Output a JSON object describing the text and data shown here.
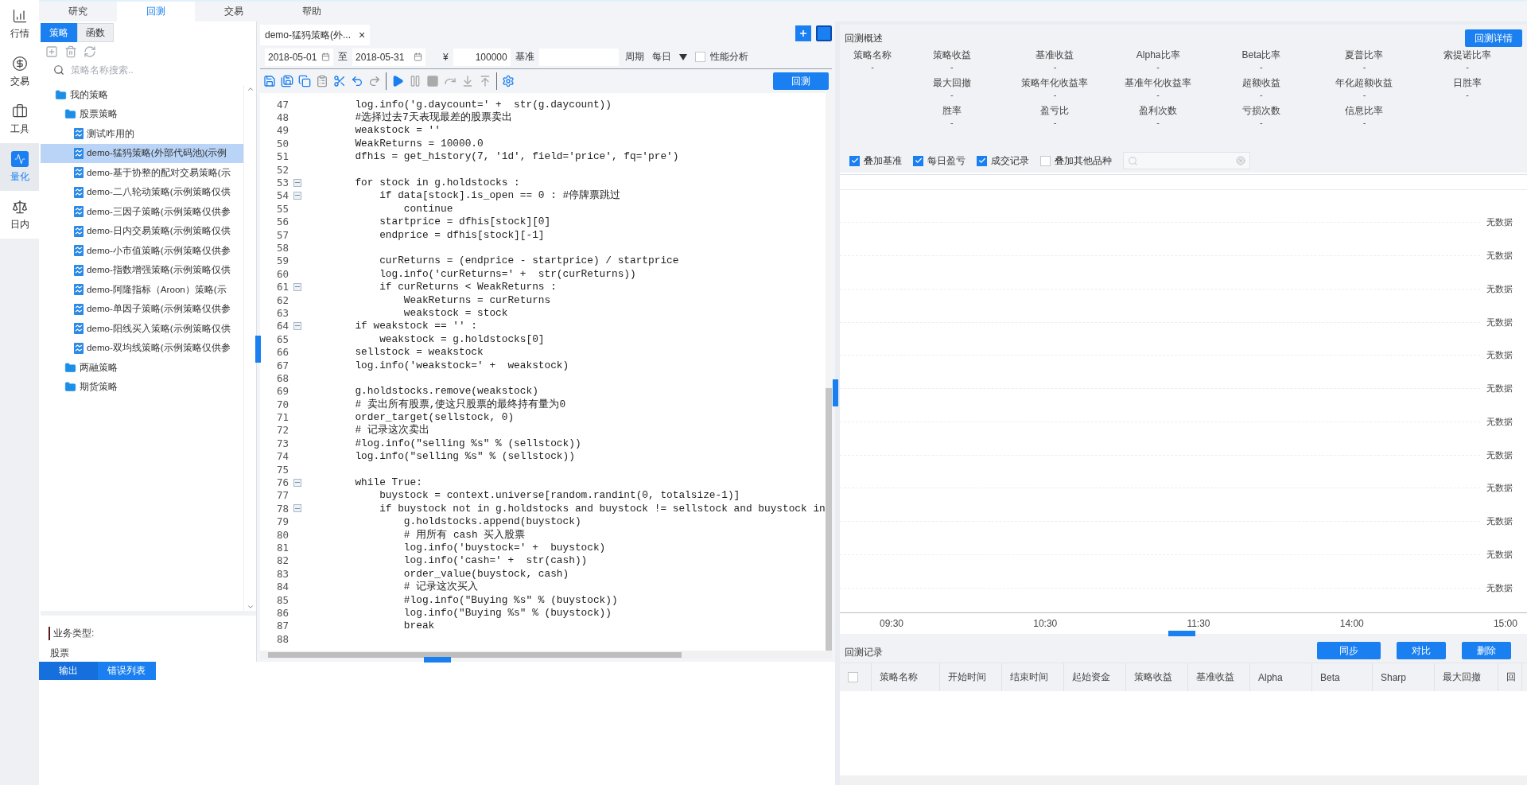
{
  "rail": [
    {
      "label": "行情",
      "selected": false
    },
    {
      "label": "交易",
      "selected": false
    },
    {
      "label": "工具",
      "selected": false
    },
    {
      "label": "量化",
      "selected": true
    },
    {
      "label": "日内",
      "selected": false
    }
  ],
  "top_tabs": [
    {
      "label": "研究",
      "selected": false
    },
    {
      "label": "回测",
      "selected": true
    },
    {
      "label": "交易",
      "selected": false
    },
    {
      "label": "帮助",
      "selected": false
    }
  ],
  "sidebar": {
    "tabs": [
      {
        "label": "策略",
        "selected": true
      },
      {
        "label": "函数",
        "selected": false
      }
    ],
    "search": {
      "placeholder": "策略名称搜索.."
    },
    "tree": [
      {
        "label": "我的策略",
        "kind": "folder",
        "selected": false,
        "children": [
          {
            "label": "股票策略",
            "kind": "folder",
            "selected": false,
            "children": [
              {
                "label": "测试咋用的",
                "kind": "file",
                "selected": false
              },
              {
                "label": "demo-猛犸策略(外部代码池)(示例",
                "kind": "file",
                "selected": true
              },
              {
                "label": "demo-基于协整的配对交易策略(示",
                "kind": "file",
                "selected": false
              },
              {
                "label": "demo-二八轮动策略(示例策略仅供",
                "kind": "file",
                "selected": false
              },
              {
                "label": "demo-三因子策略(示例策略仅供参",
                "kind": "file",
                "selected": false
              },
              {
                "label": "demo-日内交易策略(示例策略仅供",
                "kind": "file",
                "selected": false
              },
              {
                "label": "demo-小市值策略(示例策略仅供参",
                "kind": "file",
                "selected": false
              },
              {
                "label": "demo-指数增强策略(示例策略仅供",
                "kind": "file",
                "selected": false
              },
              {
                "label": "demo-阿隆指标（Aroon）策略(示",
                "kind": "file",
                "selected": false
              },
              {
                "label": "demo-单因子策略(示例策略仅供参",
                "kind": "file",
                "selected": false
              },
              {
                "label": "demo-阳线买入策略(示例策略仅供",
                "kind": "file",
                "selected": false
              },
              {
                "label": "demo-双均线策略(示例策略仅供参",
                "kind": "file",
                "selected": false
              }
            ]
          },
          {
            "label": "两融策略",
            "kind": "folder",
            "selected": false
          },
          {
            "label": "期货策略",
            "kind": "folder",
            "selected": false
          }
        ]
      }
    ],
    "info": {
      "label": "业务类型:",
      "value": "股票"
    }
  },
  "editor": {
    "tab": {
      "title": "demo-猛犸策略(外...",
      "close": "×"
    },
    "params": {
      "start_date": "2018-05-01",
      "to": "至",
      "end_date": "2018-05-31",
      "currency": "¥",
      "capital": "100000",
      "benchmark_label": "基准",
      "period_label": "周期",
      "period": "每日",
      "perf_label": "性能分析",
      "perf_checked": false
    },
    "run_button": "回测",
    "lines": [
      {
        "n": "47",
        "code": "        log.info('g.daycount=' +  str(g.daycount))",
        "fold": false
      },
      {
        "n": "48",
        "code": "        #选择过去7天表现最差的股票卖出",
        "fold": false
      },
      {
        "n": "49",
        "code": "        weakstock = ''",
        "fold": false
      },
      {
        "n": "50",
        "code": "        WeakReturns = 10000.0",
        "fold": false
      },
      {
        "n": "51",
        "code": "        dfhis = get_history(7, '1d', field='price', fq='pre')",
        "fold": false
      },
      {
        "n": "52",
        "fold": false
      },
      {
        "n": "53",
        "code": "        for stock in g.holdstocks :",
        "fold": true
      },
      {
        "n": "54",
        "code": "            if data[stock].is_open == 0 : #停牌票跳过",
        "fold": true
      },
      {
        "n": "55",
        "code": "                continue",
        "fold": false
      },
      {
        "n": "56",
        "code": "            startprice = dfhis[stock][0]",
        "fold": false
      },
      {
        "n": "57",
        "code": "            endprice = dfhis[stock][-1]",
        "fold": false
      },
      {
        "n": "58",
        "fold": false
      },
      {
        "n": "59",
        "code": "            curReturns = (endprice - startprice) / startprice",
        "fold": false
      },
      {
        "n": "60",
        "code": "            log.info('curReturns=' +  str(curReturns))",
        "fold": false
      },
      {
        "n": "61",
        "code": "            if curReturns < WeakReturns :",
        "fold": true
      },
      {
        "n": "62",
        "code": "                WeakReturns = curReturns",
        "fold": false
      },
      {
        "n": "63",
        "code": "                weakstock = stock",
        "fold": false
      },
      {
        "n": "64",
        "code": "        if weakstock == '' :",
        "fold": true
      },
      {
        "n": "65",
        "code": "            weakstock = g.holdstocks[0]",
        "fold": false
      },
      {
        "n": "66",
        "code": "        sellstock = weakstock",
        "fold": false
      },
      {
        "n": "67",
        "code": "        log.info('weakstock=' +  weakstock)",
        "fold": false
      },
      {
        "n": "68",
        "fold": false
      },
      {
        "n": "69",
        "code": "        g.holdstocks.remove(weakstock)",
        "fold": false
      },
      {
        "n": "70",
        "code": "        # 卖出所有股票,使这只股票的最终持有量为0",
        "fold": false
      },
      {
        "n": "71",
        "code": "        order_target(sellstock, 0)",
        "fold": false
      },
      {
        "n": "72",
        "code": "        # 记录这次卖出",
        "fold": false
      },
      {
        "n": "73",
        "code": "        #log.info(\"selling %s\" % (sellstock))",
        "fold": false
      },
      {
        "n": "74",
        "code": "        log.info(\"selling %s\" % (sellstock))",
        "fold": false
      },
      {
        "n": "75",
        "fold": false
      },
      {
        "n": "76",
        "code": "        while True:",
        "fold": true
      },
      {
        "n": "77",
        "code": "            buystock = context.universe[random.randint(0, totalsize-1)]",
        "fold": false
      },
      {
        "n": "78",
        "code": "            if buystock not in g.holdstocks and buystock != sellstock and buystock in",
        "fold": true
      },
      {
        "n": "79",
        "code": "                g.holdstocks.append(buystock)",
        "fold": false
      },
      {
        "n": "80",
        "code": "                # 用所有 cash 买入股票",
        "fold": false
      },
      {
        "n": "81",
        "code": "                log.info('buystock=' +  buystock)",
        "fold": false
      },
      {
        "n": "82",
        "code": "                log.info('cash=' +  str(cash))",
        "fold": false
      },
      {
        "n": "83",
        "code": "                order_value(buystock, cash)",
        "fold": false
      },
      {
        "n": "84",
        "code": "                # 记录这次买入",
        "fold": false
      },
      {
        "n": "85",
        "code": "                #log.info(\"Buying %s\" % (buystock))",
        "fold": false
      },
      {
        "n": "86",
        "code": "                log.info(\"Buying %s\" % (buystock))",
        "fold": false
      },
      {
        "n": "87",
        "code": "                break",
        "fold": false
      },
      {
        "n": "88",
        "fold": false
      }
    ]
  },
  "output": {
    "tabs": [
      {
        "label": "输出",
        "selected": true
      },
      {
        "label": "错误列表",
        "selected": false
      }
    ]
  },
  "summary": {
    "title": "回测概述",
    "detail_button": "回测详情",
    "metric_columns": [
      [
        {
          "label": "策略名称",
          "value": "-"
        }
      ],
      [
        {
          "label": "策略收益",
          "value": "-"
        },
        {
          "label": "最大回撤",
          "value": "-"
        },
        {
          "label": "胜率",
          "value": "-"
        }
      ],
      [
        {
          "label": "基准收益",
          "value": "-"
        },
        {
          "label": "策略年化收益率",
          "value": "-"
        },
        {
          "label": "盈亏比",
          "value": "-"
        }
      ],
      [
        {
          "label": "Alpha比率",
          "value": "-"
        },
        {
          "label": "基准年化收益率",
          "value": "-"
        },
        {
          "label": "盈利次数",
          "value": "-"
        }
      ],
      [
        {
          "label": "Beta比率",
          "value": "-"
        },
        {
          "label": "超额收益",
          "value": "-"
        },
        {
          "label": "亏损次数",
          "value": "-"
        }
      ],
      [
        {
          "label": "夏普比率",
          "value": "-"
        },
        {
          "label": "年化超额收益",
          "value": "-"
        },
        {
          "label": "信息比率",
          "value": "-"
        }
      ],
      [
        {
          "label": "索提诺比率",
          "value": "-"
        },
        {
          "label": "日胜率",
          "value": "-"
        }
      ]
    ],
    "toggles": [
      {
        "label": "叠加基准",
        "checked": true
      },
      {
        "label": "每日盈亏",
        "checked": true
      },
      {
        "label": "成交记录",
        "checked": true
      },
      {
        "label": "叠加其他品种",
        "checked": false
      }
    ]
  },
  "chart": {
    "y_labels": [
      "无数据",
      "无数据",
      "无数据",
      "无数据",
      "无数据",
      "无数据",
      "无数据",
      "无数据",
      "无数据",
      "无数据",
      "无数据",
      "无数据"
    ],
    "x_labels": [
      "09:30",
      "10:30",
      "11:30",
      "14:00",
      "15:00"
    ]
  },
  "records": {
    "title": "回测记录",
    "buttons": [
      "同步",
      "对比",
      "删除"
    ],
    "select_all_checked": false,
    "columns": [
      "策略名称",
      "开始时间",
      "结束时间",
      "起始资金",
      "策略收益",
      "基准收益",
      "Alpha",
      "Beta",
      "Sharp",
      "最大回撤",
      "回"
    ]
  }
}
